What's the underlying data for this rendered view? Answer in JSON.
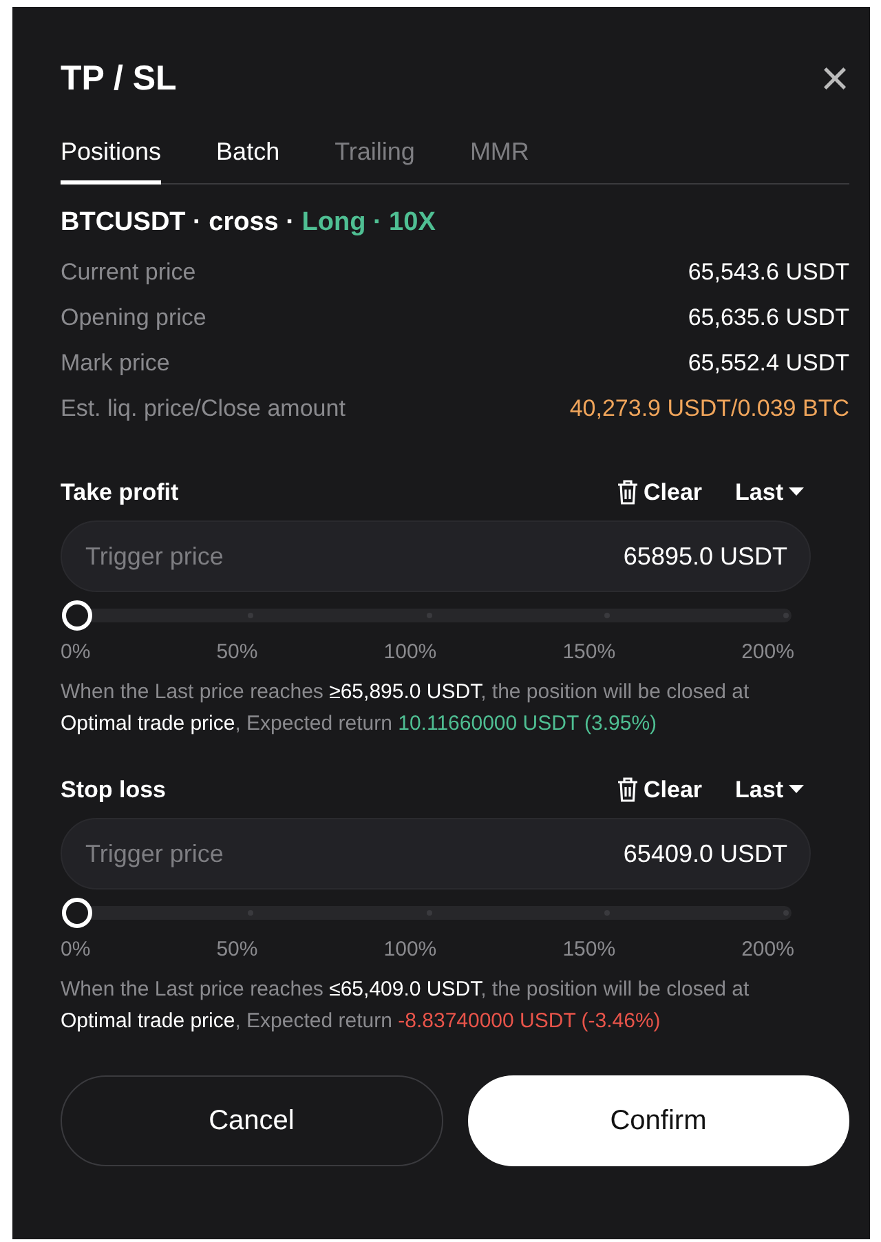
{
  "title": "TP / SL",
  "close": "×",
  "tabs": [
    {
      "label": "Positions",
      "selected": true,
      "disabled": false
    },
    {
      "label": "Batch",
      "selected": false,
      "disabled": false
    },
    {
      "label": "Trailing",
      "selected": false,
      "disabled": true
    },
    {
      "label": "MMR",
      "selected": false,
      "disabled": true
    }
  ],
  "heading_parts": [
    {
      "text": "BTCUSDT · cross ·",
      "color": "#ffffff"
    },
    {
      "text": "Long · 10X",
      "color": "#4fbf93"
    }
  ],
  "info_rows": [
    {
      "label": "Current price",
      "value": "65,543.6 USDT",
      "color": "#ffffff"
    },
    {
      "label": "Opening price",
      "value": "65,635.6 USDT",
      "color": "#ffffff"
    },
    {
      "label": "Mark price",
      "value": "65,552.4 USDT",
      "color": "#ffffff"
    },
    {
      "label": "Est. liq. price/Close amount",
      "value": "40,273.9 USDT/0.039 BTC",
      "color": "#f0a55b"
    }
  ],
  "sections": [
    {
      "title": "Take profit",
      "clear": "Clear",
      "price_type": "Last",
      "placeholder": "Trigger price",
      "value": "65895.0 USDT",
      "level": 0,
      "ticks": [
        "0%",
        "50%",
        "100%",
        "150%",
        "200%"
      ],
      "note": [
        {
          "text": "When the Last price reaches ",
          "color": "#8a8a8e"
        },
        {
          "text": "≥65,895.0 USDT",
          "color": "#ffffff"
        },
        {
          "text": ", the position will be closed at ",
          "color": "#8a8a8e"
        },
        {
          "text": "Optimal trade price",
          "color": "#ffffff"
        },
        {
          "text": ", Expected return ",
          "color": "#8a8a8e"
        },
        {
          "text": "10.11660000 USDT (3.95%)",
          "color": "#4fbf93"
        }
      ]
    },
    {
      "title": "Stop loss",
      "clear": "Clear",
      "price_type": "Last",
      "placeholder": "Trigger price",
      "value": "65409.0 USDT",
      "level": 0,
      "ticks": [
        "0%",
        "50%",
        "100%",
        "150%",
        "200%"
      ],
      "note": [
        {
          "text": "When the Last price reaches ",
          "color": "#8a8a8e"
        },
        {
          "text": "≤65,409.0 USDT",
          "color": "#ffffff"
        },
        {
          "text": ", the position will be closed at ",
          "color": "#8a8a8e"
        },
        {
          "text": "Optimal trade price",
          "color": "#ffffff"
        },
        {
          "text": ", Expected return ",
          "color": "#8a8a8e"
        },
        {
          "text": "-8.83740000 USDT (-3.46%)",
          "color": "#e8544a"
        }
      ]
    }
  ],
  "buttons": [
    {
      "label": "Cancel",
      "kind": "secondary"
    },
    {
      "label": "Confirm",
      "kind": "primary"
    }
  ]
}
